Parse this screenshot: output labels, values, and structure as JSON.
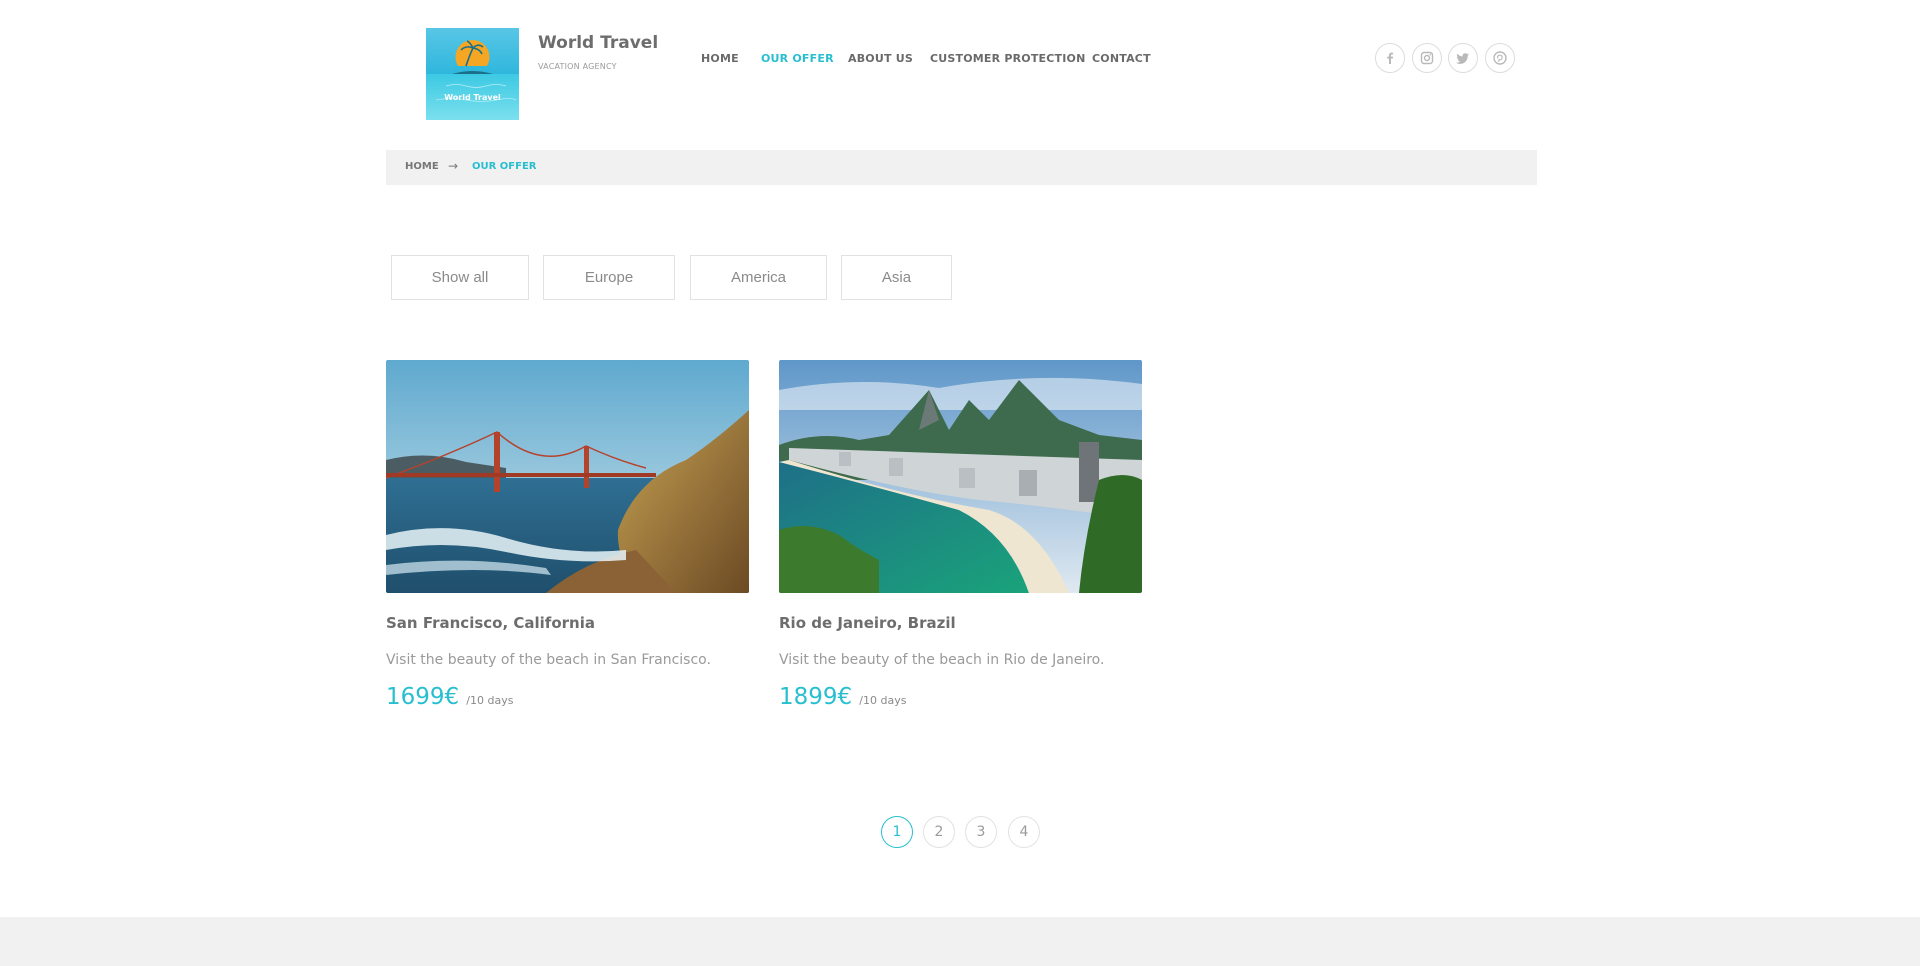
{
  "brand": {
    "name": "World Travel",
    "tagline": "VACATION AGENCY",
    "logo_text": "World Travel"
  },
  "nav": [
    {
      "label": "HOME",
      "active": false
    },
    {
      "label": "OUR OFFER",
      "active": true
    },
    {
      "label": "ABOUT US",
      "active": false
    },
    {
      "label": "CUSTOMER PROTECTION",
      "active": false
    },
    {
      "label": "CONTACT",
      "active": false
    }
  ],
  "social": [
    "facebook-icon",
    "instagram-icon",
    "twitter-icon",
    "pinterest-icon"
  ],
  "breadcrumb": {
    "home": "HOME",
    "separator": "→",
    "current": "OUR OFFER"
  },
  "filters": [
    "Show all",
    "Europe",
    "America",
    "Asia"
  ],
  "offers": [
    {
      "title": "San Francisco, California",
      "description": "Visit the beauty of the beach in San Francisco.",
      "price": "1699€",
      "period": "/10 days",
      "image": "golden-gate-bridge-beach-photo"
    },
    {
      "title": "Rio de Janeiro, Brazil",
      "description": "Visit the beauty of the beach in Rio de Janeiro.",
      "price": "1899€",
      "period": "/10 days",
      "image": "copacabana-beach-photo"
    }
  ],
  "pagination": {
    "pages": [
      "1",
      "2",
      "3",
      "4"
    ],
    "current": "1"
  },
  "colors": {
    "accent": "#27bfd0",
    "text": "#6d6d6d",
    "muted": "#9a9a9a",
    "panel": "#f1f1f1",
    "border": "#e2e2e2"
  }
}
